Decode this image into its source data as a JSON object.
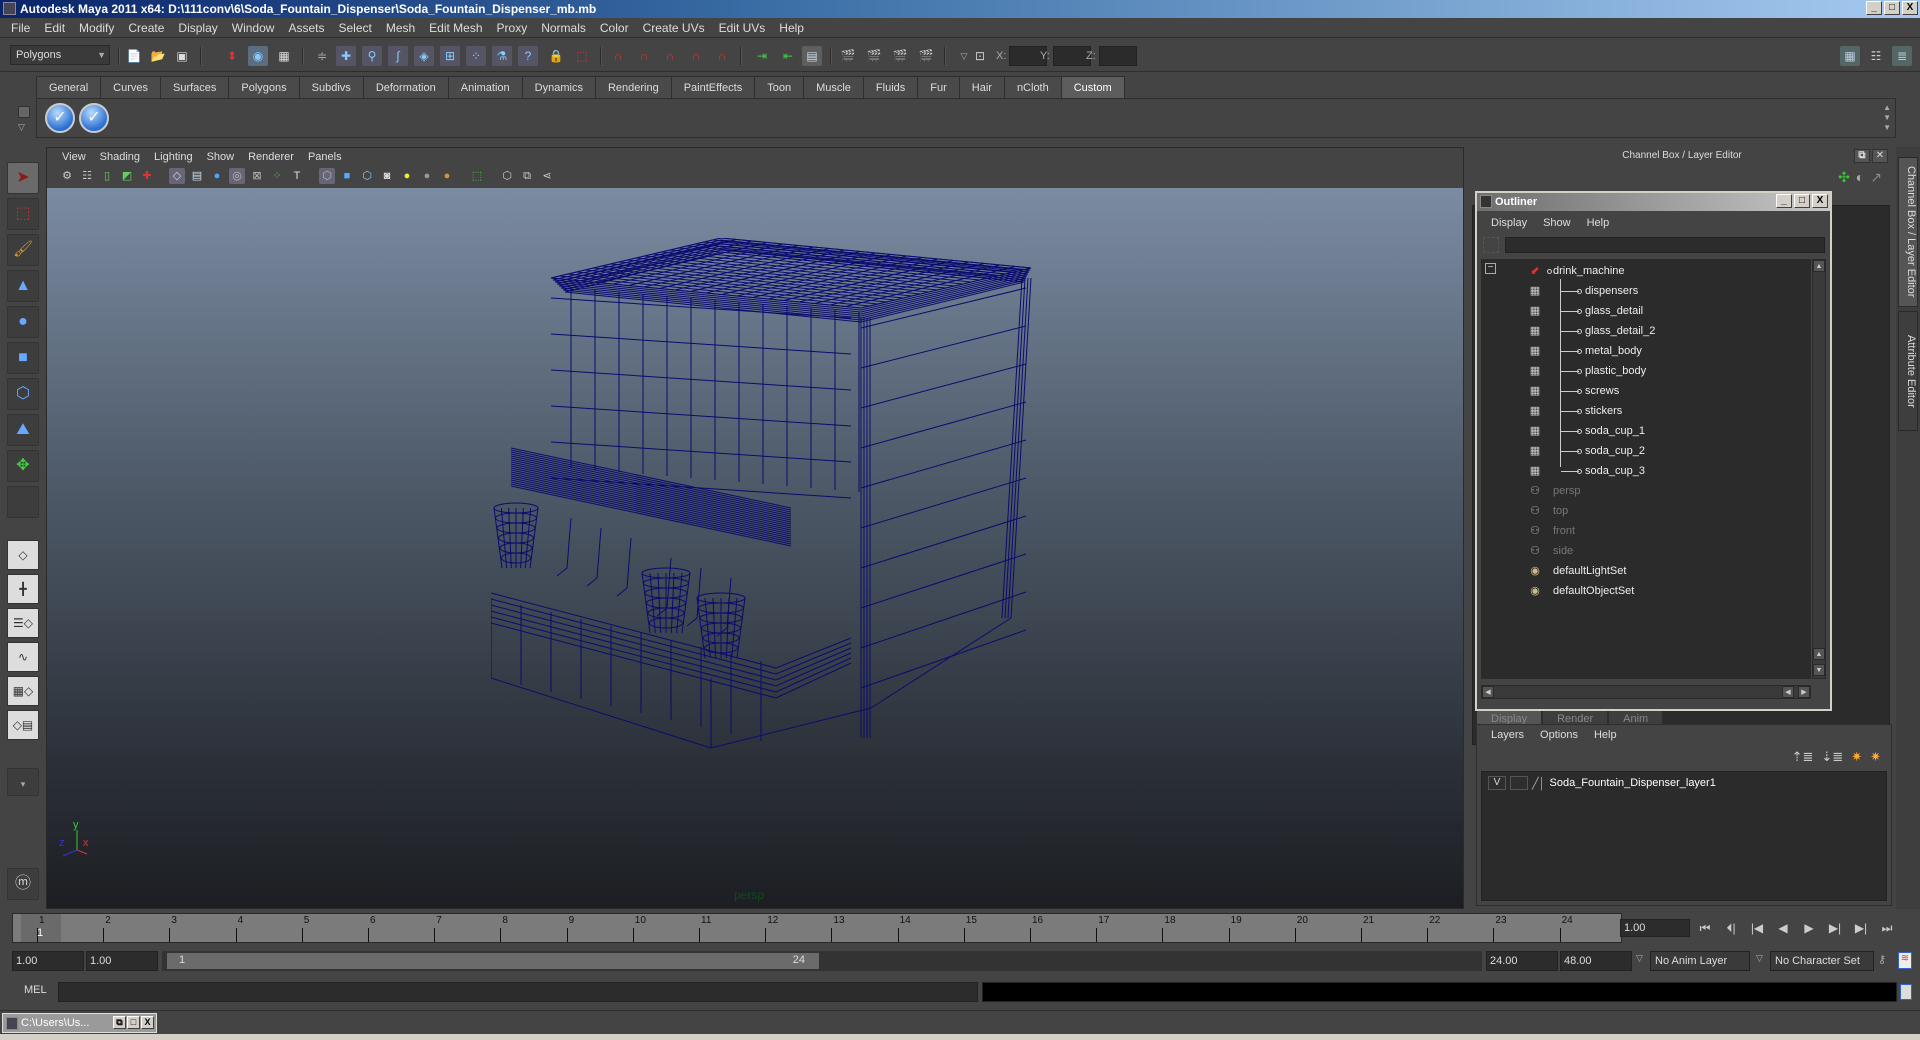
{
  "window": {
    "title": "Autodesk Maya 2011 x64: D:\\111conv\\6\\Soda_Fountain_Dispenser\\Soda_Fountain_Dispenser_mb.mb",
    "controls": [
      "_",
      "□",
      "X"
    ]
  },
  "menubar": [
    "File",
    "Edit",
    "Modify",
    "Create",
    "Display",
    "Window",
    "Assets",
    "Select",
    "Mesh",
    "Edit Mesh",
    "Proxy",
    "Normals",
    "Color",
    "Create UVs",
    "Edit UVs",
    "Help"
  ],
  "statusline": {
    "mode": "Polygons",
    "x_label": "X:",
    "y_label": "Y:",
    "z_label": "Z:",
    "x_value": "",
    "y_value": "",
    "z_value": ""
  },
  "shelf": {
    "tabs": [
      "General",
      "Curves",
      "Surfaces",
      "Polygons",
      "Subdivs",
      "Deformation",
      "Animation",
      "Dynamics",
      "Rendering",
      "PaintEffects",
      "Toon",
      "Muscle",
      "Fluids",
      "Fur",
      "Hair",
      "nCloth",
      "Custom"
    ],
    "active_tab": "Custom",
    "icons": [
      "checkmark-icon",
      "checkmark-icon"
    ]
  },
  "viewport": {
    "menu": [
      "View",
      "Shading",
      "Lighting",
      "Show",
      "Renderer",
      "Panels"
    ],
    "camera_label": "persp",
    "axis": {
      "x": "x",
      "y": "y",
      "z": "z"
    },
    "wire_color": "#0b0b6e"
  },
  "channelbox": {
    "header": "Channel Box / Layer Editor"
  },
  "sidetabs": [
    "Channel Box / Layer Editor",
    "Attribute Editor"
  ],
  "outliner": {
    "title": "Outliner",
    "menu": [
      "Display",
      "Show",
      "Help"
    ],
    "filter_value": "",
    "items": [
      {
        "label": "drink_machine",
        "type": "group",
        "dim": false
      },
      {
        "label": "dispensers",
        "type": "mesh",
        "dim": false
      },
      {
        "label": "glass_detail",
        "type": "mesh",
        "dim": false
      },
      {
        "label": "glass_detail_2",
        "type": "mesh",
        "dim": false
      },
      {
        "label": "metal_body",
        "type": "mesh",
        "dim": false
      },
      {
        "label": "plastic_body",
        "type": "mesh",
        "dim": false
      },
      {
        "label": "screws",
        "type": "mesh",
        "dim": false
      },
      {
        "label": "stickers",
        "type": "mesh",
        "dim": false
      },
      {
        "label": "soda_cup_1",
        "type": "mesh",
        "dim": false
      },
      {
        "label": "soda_cup_2",
        "type": "mesh",
        "dim": false
      },
      {
        "label": "soda_cup_3",
        "type": "mesh",
        "dim": false
      },
      {
        "label": "persp",
        "type": "camera",
        "dim": true
      },
      {
        "label": "top",
        "type": "camera",
        "dim": true
      },
      {
        "label": "front",
        "type": "camera",
        "dim": true
      },
      {
        "label": "side",
        "type": "camera",
        "dim": true
      },
      {
        "label": "defaultLightSet",
        "type": "set",
        "dim": false
      },
      {
        "label": "defaultObjectSet",
        "type": "set",
        "dim": false
      }
    ]
  },
  "layers": {
    "tabs": [
      "Display",
      "Render",
      "Anim"
    ],
    "active_tab": "Display",
    "menu": [
      "Layers",
      "Options",
      "Help"
    ],
    "rows": [
      {
        "visible": "V",
        "playback": "",
        "name": "Soda_Fountain_Dispenser_layer1"
      }
    ]
  },
  "timeline": {
    "ticks": [
      "1",
      "2",
      "3",
      "4",
      "5",
      "6",
      "7",
      "8",
      "9",
      "10",
      "11",
      "12",
      "13",
      "14",
      "15",
      "16",
      "17",
      "18",
      "19",
      "20",
      "21",
      "22",
      "23",
      "24"
    ],
    "current_frame_marker": "1",
    "current_frame": "1.00"
  },
  "range": {
    "start": "1.00",
    "playback_start": "1.00",
    "bar_start": "1",
    "bar_end": "24",
    "playback_end": "24.00",
    "end": "48.00",
    "anim_layer": "No Anim Layer",
    "character_set": "No Character Set"
  },
  "cmdline": {
    "label": "MEL",
    "input": "",
    "output": ""
  },
  "taskbar": {
    "window_label": "C:\\Users\\Us..."
  }
}
